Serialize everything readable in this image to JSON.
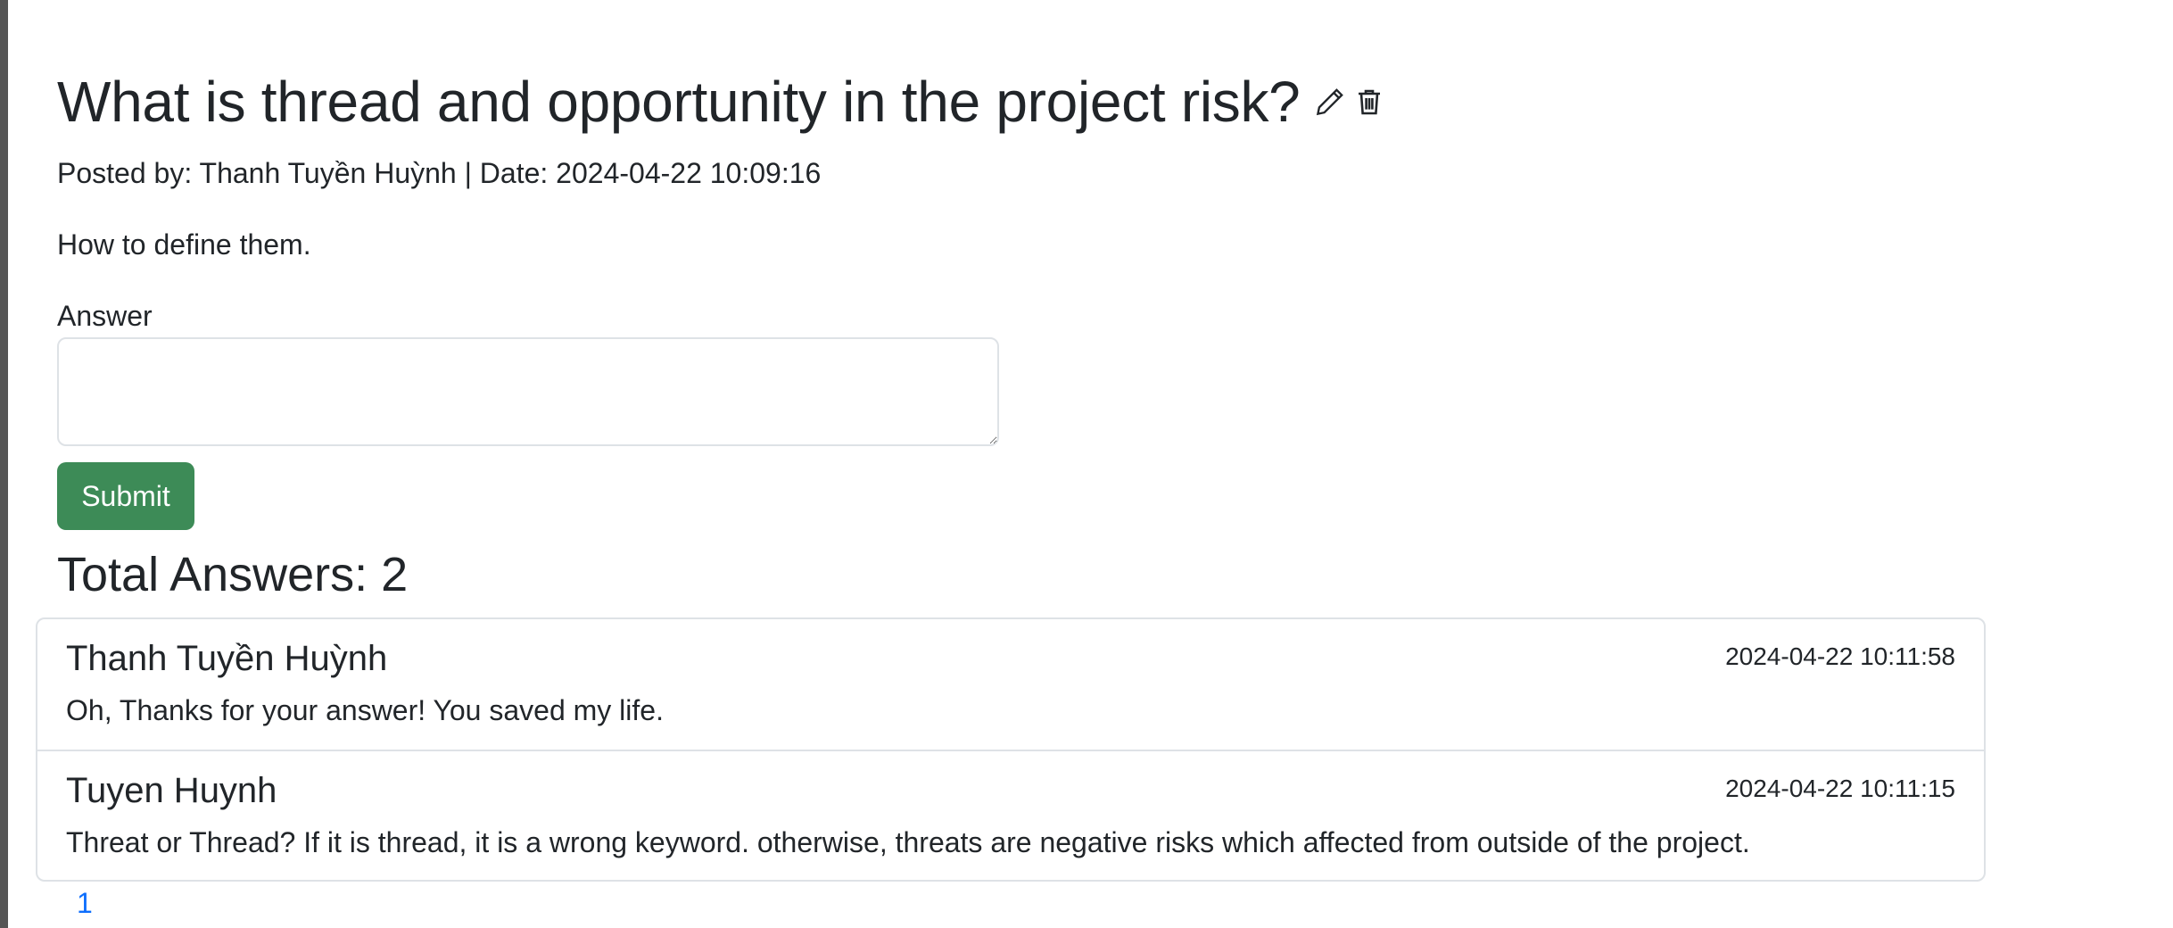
{
  "question": {
    "title": "What is thread and opportunity in the project risk?",
    "edit_icon": "pencil-icon",
    "delete_icon": "trash-icon",
    "meta": "Posted by: Thanh Tuyền Huỳnh | Date: 2024-04-22 10:09:16",
    "body": "How to define them."
  },
  "answer_form": {
    "label": "Answer",
    "value": "",
    "placeholder": "",
    "submit_label": "Submit",
    "submit_color": "#3d8b57"
  },
  "answers_section": {
    "total_label": "Total Answers: 2",
    "items": [
      {
        "author": "Thanh Tuyền Huỳnh",
        "date": "2024-04-22 10:11:58",
        "text": "Oh, Thanks for your answer! You saved my life."
      },
      {
        "author": "Tuyen Huynh",
        "date": "2024-04-22 10:11:15",
        "text": "Threat or Thread? If it is thread, it is a wrong keyword. otherwise, threats are negative risks which affected from outside of the project."
      }
    ]
  },
  "pagination": {
    "current_page": "1",
    "link_color": "#0d6efd"
  }
}
